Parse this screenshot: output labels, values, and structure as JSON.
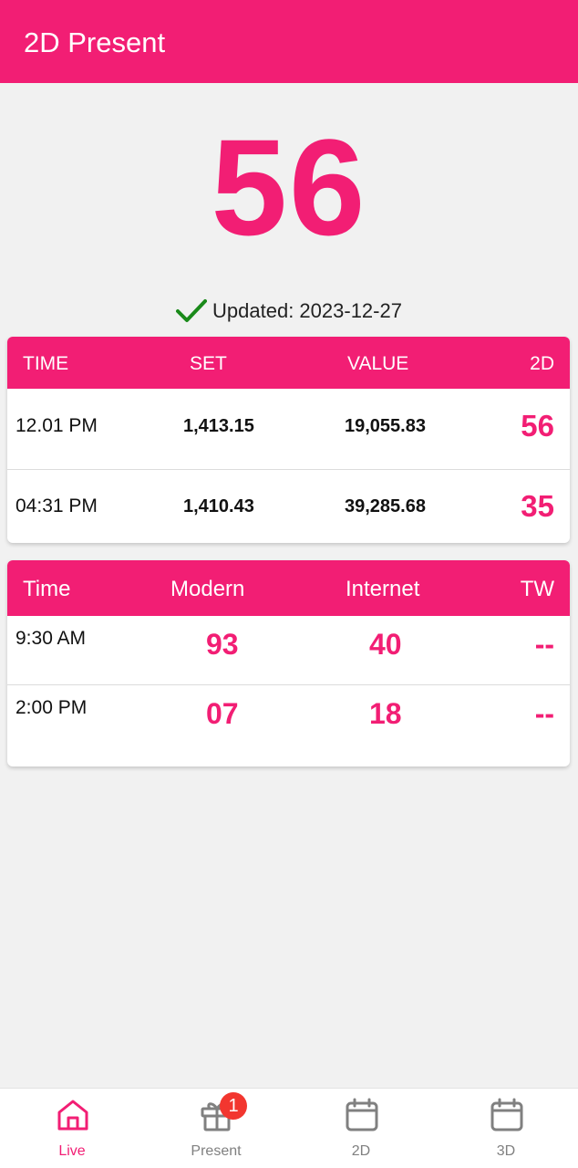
{
  "app": {
    "title": "2D Present"
  },
  "hero": {
    "number": "56",
    "updated_text": "Updated: 2023-12-27"
  },
  "table1": {
    "headers": [
      "TIME",
      "SET",
      "VALUE",
      "2D"
    ],
    "rows": [
      {
        "time": "12.01 PM",
        "set": "1,413.15",
        "value": "19,055.83",
        "d2": "56"
      },
      {
        "time": "04:31 PM",
        "set": "1,410.43",
        "value": "39,285.68",
        "d2": "35"
      }
    ]
  },
  "table2": {
    "headers": [
      "Time",
      "Modern",
      "Internet",
      "TW"
    ],
    "rows": [
      {
        "time": "9:30 AM",
        "modern": "93",
        "internet": "40",
        "tw": "--"
      },
      {
        "time": "2:00 PM",
        "modern": "07",
        "internet": "18",
        "tw": "--"
      }
    ]
  },
  "nav": {
    "items": [
      {
        "label": "Live",
        "icon": "home-icon",
        "active": true
      },
      {
        "label": "Present",
        "icon": "gift-icon",
        "badge": "1"
      },
      {
        "label": "2D",
        "icon": "calendar-icon"
      },
      {
        "label": "3D",
        "icon": "calendar-icon"
      }
    ]
  },
  "colors": {
    "accent": "#f21e74",
    "check": "#1a8a1a",
    "badge": "#f2362f"
  }
}
